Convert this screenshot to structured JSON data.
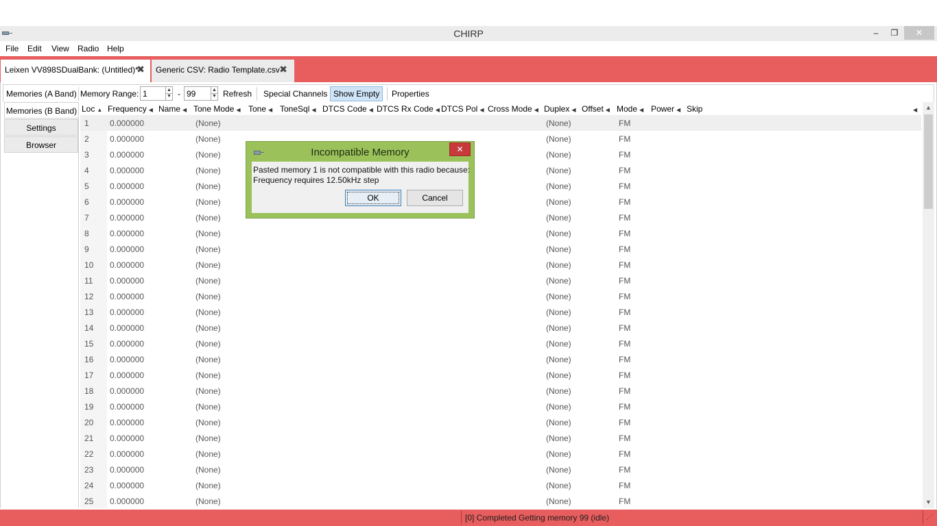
{
  "window": {
    "title": "CHIRP",
    "min_glyph": "–",
    "max_glyph": "❐",
    "close_glyph": "✕"
  },
  "menu": [
    "File",
    "Edit",
    "View",
    "Radio",
    "Help"
  ],
  "tabs": [
    {
      "label": "Leixen VV898SDualBank: (Untitled)*",
      "close_glyph": "✖"
    },
    {
      "label": "Generic CSV: Radio Template.csv",
      "close_glyph": "✖"
    }
  ],
  "toolbar": {
    "band_label": "Memories (A Band)",
    "range_label": "Memory Range:",
    "range_start": "1",
    "range_sep": "-",
    "range_end": "99",
    "refresh": "Refresh",
    "special_channels": "Special Channels",
    "show_empty": "Show Empty",
    "properties": "Properties"
  },
  "side_tabs": [
    "Memories (B Band)",
    "Settings",
    "Browser"
  ],
  "columns": [
    "Loc",
    "Frequency",
    "Name",
    "Tone Mode",
    "Tone",
    "ToneSql",
    "DTCS Code",
    "DTCS Rx Code",
    "DTCS Pol",
    "Cross Mode",
    "Duplex",
    "Offset",
    "Mode",
    "Power",
    "Skip"
  ],
  "sort_glyphs": {
    "asc": "▲",
    "col": "◀"
  },
  "rows": [
    {
      "loc": "1",
      "frequency": "0.000000",
      "tone_mode": "(None)",
      "duplex": "(None)",
      "mode": "FM"
    },
    {
      "loc": "2",
      "frequency": "0.000000",
      "tone_mode": "(None)",
      "duplex": "(None)",
      "mode": "FM"
    },
    {
      "loc": "3",
      "frequency": "0.000000",
      "tone_mode": "(None)",
      "duplex": "(None)",
      "mode": "FM"
    },
    {
      "loc": "4",
      "frequency": "0.000000",
      "tone_mode": "(None)",
      "duplex": "(None)",
      "mode": "FM"
    },
    {
      "loc": "5",
      "frequency": "0.000000",
      "tone_mode": "(None)",
      "duplex": "(None)",
      "mode": "FM"
    },
    {
      "loc": "6",
      "frequency": "0.000000",
      "tone_mode": "(None)",
      "duplex": "(None)",
      "mode": "FM"
    },
    {
      "loc": "7",
      "frequency": "0.000000",
      "tone_mode": "(None)",
      "duplex": "(None)",
      "mode": "FM"
    },
    {
      "loc": "8",
      "frequency": "0.000000",
      "tone_mode": "(None)",
      "duplex": "(None)",
      "mode": "FM"
    },
    {
      "loc": "9",
      "frequency": "0.000000",
      "tone_mode": "(None)",
      "duplex": "(None)",
      "mode": "FM"
    },
    {
      "loc": "10",
      "frequency": "0.000000",
      "tone_mode": "(None)",
      "duplex": "(None)",
      "mode": "FM"
    },
    {
      "loc": "11",
      "frequency": "0.000000",
      "tone_mode": "(None)",
      "duplex": "(None)",
      "mode": "FM"
    },
    {
      "loc": "12",
      "frequency": "0.000000",
      "tone_mode": "(None)",
      "duplex": "(None)",
      "mode": "FM"
    },
    {
      "loc": "13",
      "frequency": "0.000000",
      "tone_mode": "(None)",
      "duplex": "(None)",
      "mode": "FM"
    },
    {
      "loc": "14",
      "frequency": "0.000000",
      "tone_mode": "(None)",
      "duplex": "(None)",
      "mode": "FM"
    },
    {
      "loc": "15",
      "frequency": "0.000000",
      "tone_mode": "(None)",
      "duplex": "(None)",
      "mode": "FM"
    },
    {
      "loc": "16",
      "frequency": "0.000000",
      "tone_mode": "(None)",
      "duplex": "(None)",
      "mode": "FM"
    },
    {
      "loc": "17",
      "frequency": "0.000000",
      "tone_mode": "(None)",
      "duplex": "(None)",
      "mode": "FM"
    },
    {
      "loc": "18",
      "frequency": "0.000000",
      "tone_mode": "(None)",
      "duplex": "(None)",
      "mode": "FM"
    },
    {
      "loc": "19",
      "frequency": "0.000000",
      "tone_mode": "(None)",
      "duplex": "(None)",
      "mode": "FM"
    },
    {
      "loc": "20",
      "frequency": "0.000000",
      "tone_mode": "(None)",
      "duplex": "(None)",
      "mode": "FM"
    },
    {
      "loc": "21",
      "frequency": "0.000000",
      "tone_mode": "(None)",
      "duplex": "(None)",
      "mode": "FM"
    },
    {
      "loc": "22",
      "frequency": "0.000000",
      "tone_mode": "(None)",
      "duplex": "(None)",
      "mode": "FM"
    },
    {
      "loc": "23",
      "frequency": "0.000000",
      "tone_mode": "(None)",
      "duplex": "(None)",
      "mode": "FM"
    },
    {
      "loc": "24",
      "frequency": "0.000000",
      "tone_mode": "(None)",
      "duplex": "(None)",
      "mode": "FM"
    },
    {
      "loc": "25",
      "frequency": "0.000000",
      "tone_mode": "(None)",
      "duplex": "(None)",
      "mode": "FM"
    }
  ],
  "status": {
    "text": "[0] Completed Getting memory 99 (idle)",
    "grip_glyph": "⋰"
  },
  "dialog": {
    "title": "Incompatible Memory",
    "close_glyph": "✕",
    "message_line1": "Pasted memory 1 is not compatible with this radio because:",
    "message_line2": "Frequency requires 12.50kHz step",
    "ok": "OK",
    "cancel": "Cancel"
  },
  "scroll_glyphs": {
    "up": "▲",
    "down": "▼"
  },
  "colors": {
    "accent": "#e85e5e",
    "dialog_frame": "#9bc25a",
    "dialog_close": "#c7393a",
    "selected_button": "#cfe4f7"
  }
}
